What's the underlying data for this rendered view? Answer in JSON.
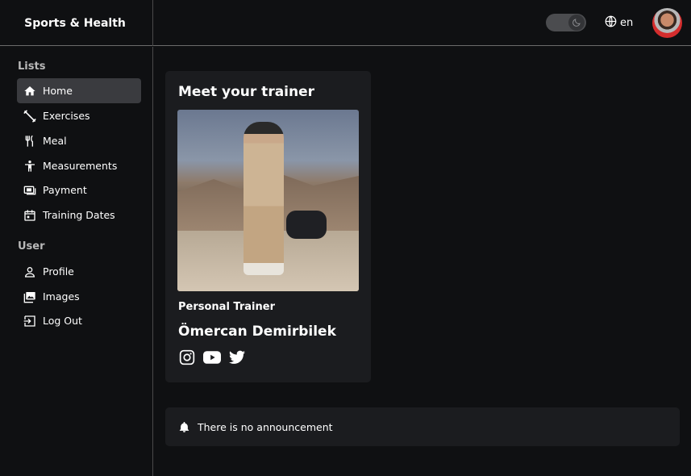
{
  "header": {
    "brand": "Sports & Health",
    "language": "en"
  },
  "sidebar": {
    "sections": [
      {
        "title": "Lists",
        "items": [
          {
            "label": "Home",
            "icon": "home-icon",
            "active": true
          },
          {
            "label": "Exercises",
            "icon": "dumbbell-icon"
          },
          {
            "label": "Meal",
            "icon": "utensils-icon"
          },
          {
            "label": "Measurements",
            "icon": "person-icon"
          },
          {
            "label": "Payment",
            "icon": "money-icon"
          },
          {
            "label": "Training Dates",
            "icon": "calendar-icon"
          }
        ]
      },
      {
        "title": "User",
        "items": [
          {
            "label": "Profile",
            "icon": "user-icon"
          },
          {
            "label": "Images",
            "icon": "images-icon"
          },
          {
            "label": "Log Out",
            "icon": "logout-icon"
          }
        ]
      }
    ]
  },
  "trainer_card": {
    "title": "Meet your trainer",
    "role": "Personal Trainer",
    "name": "Ömercan Demirbilek",
    "socials": [
      "instagram-icon",
      "youtube-icon",
      "twitter-icon"
    ]
  },
  "announcement": {
    "text": "There is no announcement"
  },
  "colors": {
    "background": "#0f1012",
    "card": "#1b1c1f",
    "active_item": "#3a3b3f"
  }
}
